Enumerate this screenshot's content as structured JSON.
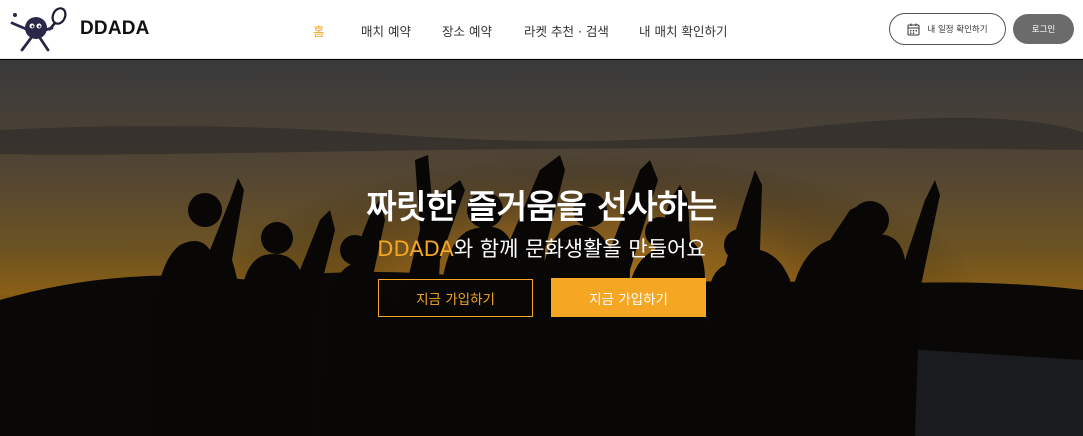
{
  "header": {
    "brand": "DDADA",
    "logo_icon": "racket-mascot-icon",
    "nav": [
      {
        "label": "홈",
        "active": true
      },
      {
        "label": "매치 예약",
        "active": false
      },
      {
        "label": "장소 예약",
        "active": false
      },
      {
        "label": "라켓 추천 · 검색",
        "active": false
      },
      {
        "label": "내 매치 확인하기",
        "active": false
      }
    ],
    "schedule_button": {
      "label": "내 일정 확인하기",
      "icon": "calendar-icon"
    },
    "login_button": {
      "label": "로그인"
    }
  },
  "hero": {
    "title": "짜릿한 즐거움을 선사하는",
    "subtitle_accent": "DDADA",
    "subtitle_rest": "와 함께 문화생활을 만들어요",
    "cta_outline": "지금 가입하기",
    "cta_filled": "지금 가입하기",
    "background_image": "silhouettes-raising-hands-at-sunset"
  },
  "colors": {
    "accent": "#f5a623",
    "login_bg": "#6b6b6b"
  }
}
